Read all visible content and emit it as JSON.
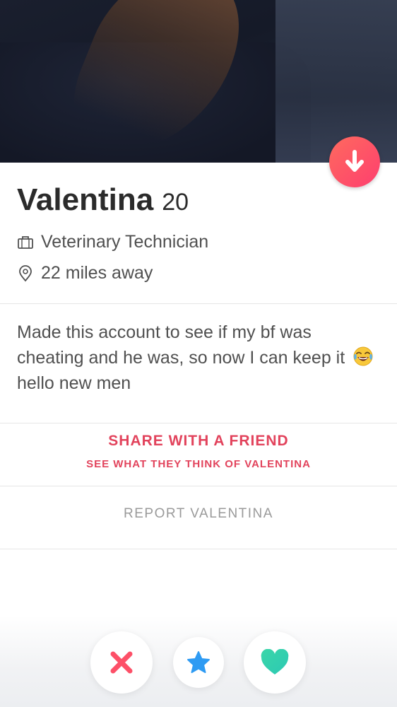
{
  "profile": {
    "name": "Valentina",
    "age": "20",
    "job": "Veterinary Technician",
    "distance": "22 miles away",
    "bio_part1": "Made this account to see if my bf was cheating and he was, so now I can keep it",
    "bio_part2": "hello new men"
  },
  "share": {
    "title": "SHARE WITH A FRIEND",
    "subtitle": "SEE WHAT THEY THINK OF VALENTINA"
  },
  "report": {
    "label": "REPORT VALENTINA"
  },
  "colors": {
    "accent": "#e2435c",
    "nope": "#fd5068",
    "superlike": "#2e9bf3",
    "like": "#3ad6a8"
  },
  "icons": [
    "arrow-down-icon",
    "briefcase-icon",
    "location-pin-icon",
    "laughing-emoji-icon",
    "close-icon",
    "star-icon",
    "heart-icon"
  ]
}
